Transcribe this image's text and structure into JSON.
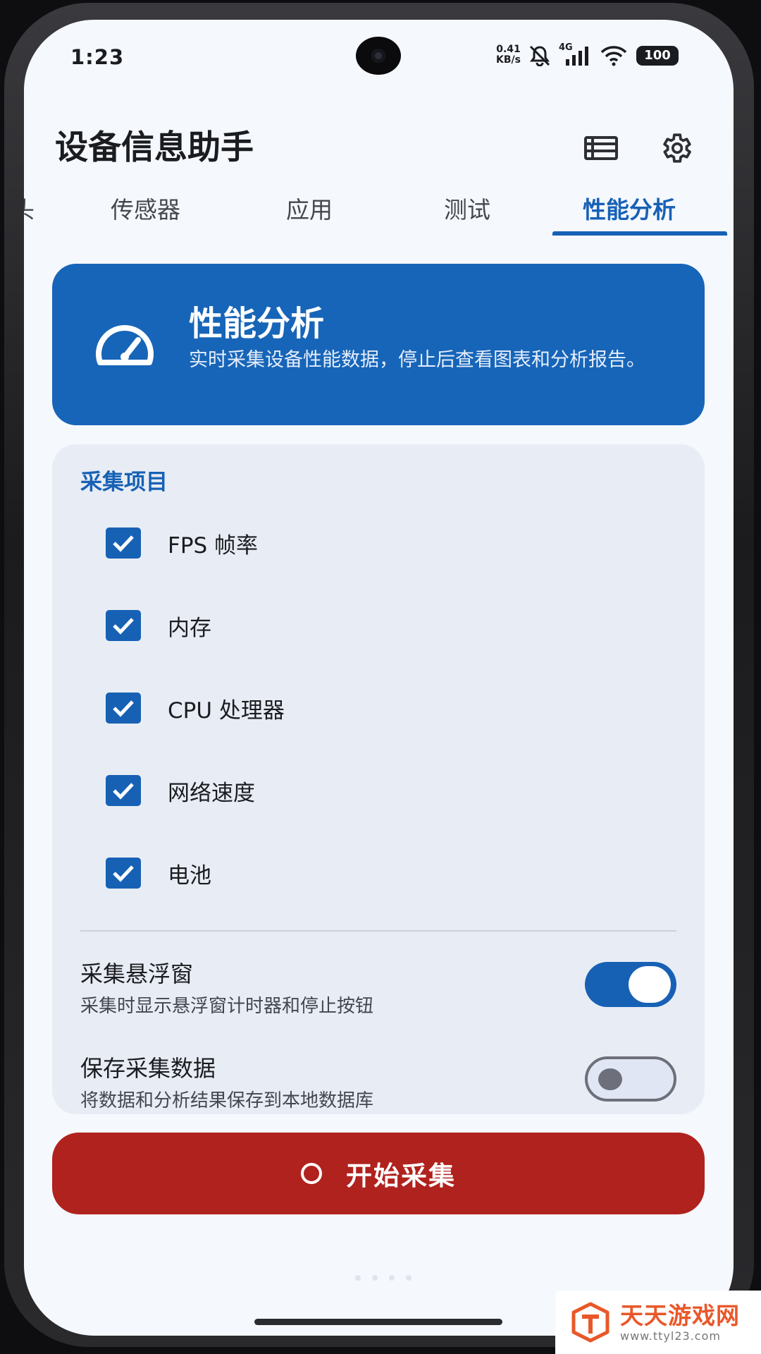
{
  "status_bar": {
    "time": "1:23",
    "net_speed_value": "0.41",
    "net_speed_unit": "KB/s",
    "network": "4G",
    "battery": "100"
  },
  "app_bar": {
    "title": "设备信息助手",
    "list_icon": "list-icon",
    "settings_icon": "gear-icon"
  },
  "tabs": [
    {
      "label": "头",
      "active": false
    },
    {
      "label": "传感器",
      "active": false
    },
    {
      "label": "应用",
      "active": false
    },
    {
      "label": "测试",
      "active": false
    },
    {
      "label": "性能分析",
      "active": true
    }
  ],
  "banner": {
    "title": "性能分析",
    "description": "实时采集设备性能数据，停止后查看图表和分析报告。",
    "icon": "speedometer-icon"
  },
  "collect": {
    "title": "采集项目",
    "items": [
      {
        "label": "FPS 帧率",
        "checked": true
      },
      {
        "label": "内存",
        "checked": true
      },
      {
        "label": "CPU 处理器",
        "checked": true
      },
      {
        "label": "网络速度",
        "checked": true
      },
      {
        "label": "电池",
        "checked": true
      }
    ],
    "settings": [
      {
        "title": "采集悬浮窗",
        "description": "采集时显示悬浮窗计时器和停止按钮",
        "on": true
      },
      {
        "title": "保存采集数据",
        "description": "将数据和分析结果保存到本地数据库",
        "on": false
      }
    ]
  },
  "start_button": {
    "label": "开始采集"
  },
  "watermark": {
    "name": "天天游戏网",
    "url": "www.ttyl23.com"
  },
  "colors": {
    "primary": "#1761b5",
    "danger": "#b0221e",
    "background": "#f5f8fd",
    "card": "#e8edf5"
  }
}
